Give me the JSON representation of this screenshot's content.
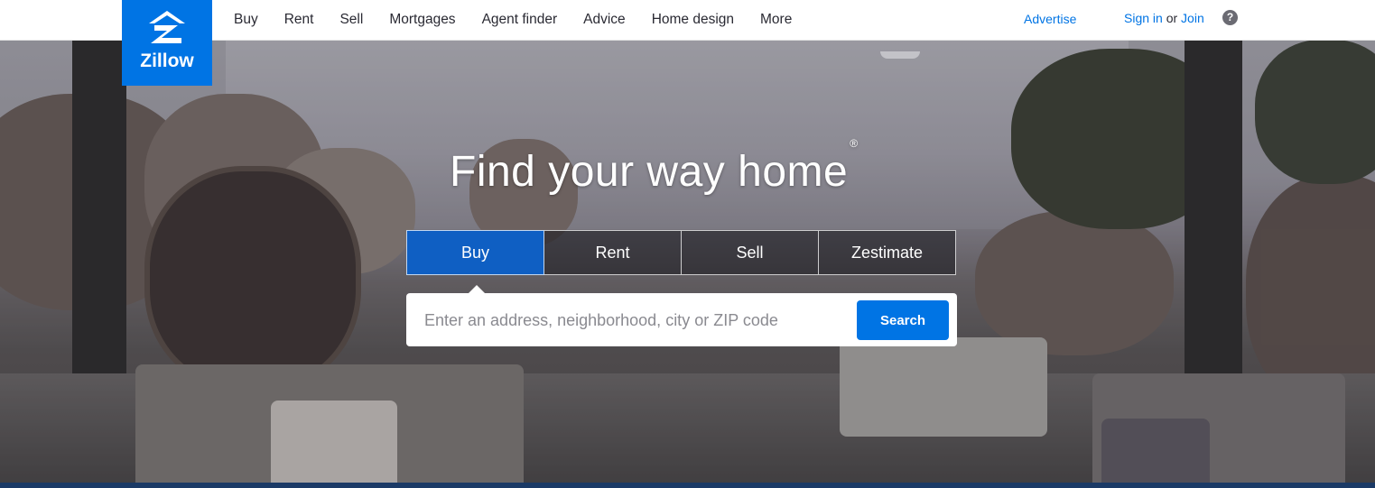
{
  "brand": {
    "name": "Zillow",
    "color": "#0074e4",
    "icon": "zillow-z-logo-icon"
  },
  "nav": {
    "items": [
      "Buy",
      "Rent",
      "Sell",
      "Mortgages",
      "Agent finder",
      "Advice",
      "Home design",
      "More"
    ]
  },
  "header_right": {
    "advertise": "Advertise",
    "sign_in": "Sign in",
    "or": "or",
    "join": "Join",
    "help": "?"
  },
  "hero": {
    "headline": "Find your way home",
    "trademark": "®",
    "tabs": [
      {
        "label": "Buy",
        "active": true
      },
      {
        "label": "Rent",
        "active": false
      },
      {
        "label": "Sell",
        "active": false
      },
      {
        "label": "Zestimate",
        "active": false
      }
    ],
    "search": {
      "placeholder": "Enter an address, neighborhood, city or ZIP code",
      "value": "",
      "button": "Search"
    }
  }
}
